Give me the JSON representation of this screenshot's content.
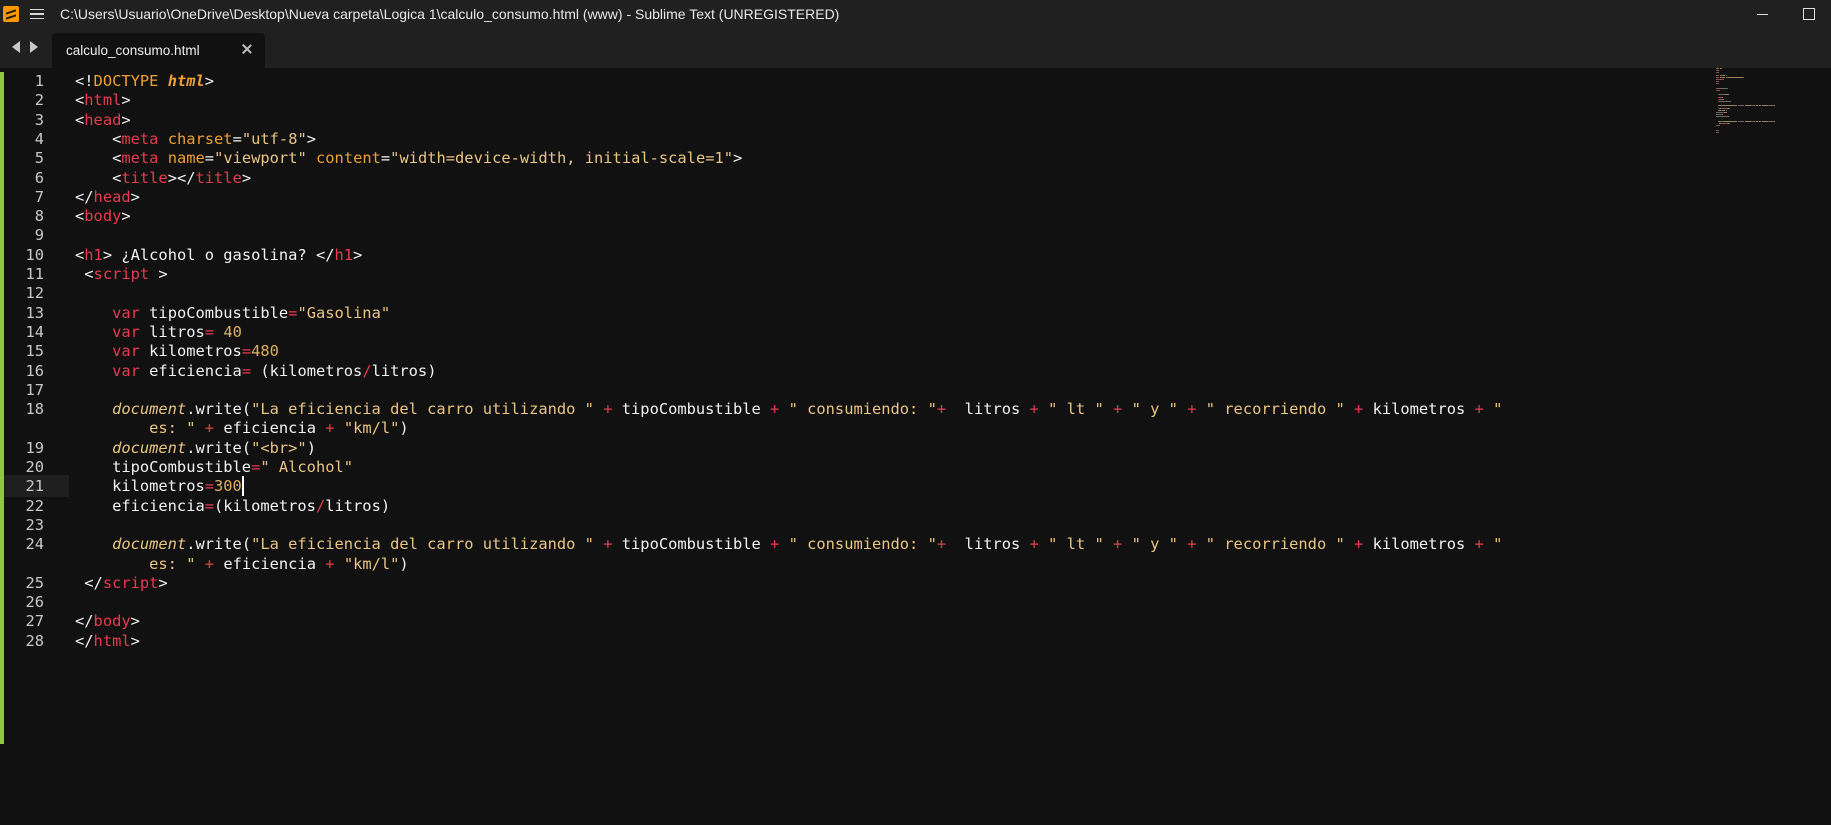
{
  "window": {
    "title": "C:\\Users\\Usuario\\OneDrive\\Desktop\\Nueva carpeta\\Logica 1\\calculo_consumo.html (www) - Sublime Text (UNREGISTERED)"
  },
  "tabs": [
    {
      "label": "calculo_consumo.html",
      "active": true
    }
  ],
  "icons": {
    "app": "sublime-text-icon",
    "menu": "hamburger-menu-icon",
    "back": "arrow-left-icon",
    "forward": "arrow-right-icon",
    "close_tab": "close-icon",
    "minimize": "minimize-icon",
    "maximize": "maximize-icon"
  },
  "colors": {
    "tag": "#e83a4f",
    "attribute": "#f0a030",
    "string": "#eac584",
    "keyword": "#e83a4f",
    "modified_gutter": "#8fc93a",
    "background": "#111111"
  },
  "editor": {
    "cursor_line": 21,
    "lines": [
      {
        "n": "1",
        "segs": [
          [
            "<!",
            "t-punc"
          ],
          [
            "DOCTYPE",
            "t-attr"
          ],
          [
            " ",
            "t-punc"
          ],
          [
            "html",
            "t-doctype"
          ],
          [
            ">",
            "t-punc"
          ]
        ]
      },
      {
        "n": "2",
        "segs": [
          [
            "<",
            "t-punc"
          ],
          [
            "html",
            "t-tag"
          ],
          [
            ">",
            "t-punc"
          ]
        ]
      },
      {
        "n": "3",
        "segs": [
          [
            "<",
            "t-punc"
          ],
          [
            "head",
            "t-tag"
          ],
          [
            ">",
            "t-punc"
          ]
        ]
      },
      {
        "n": "4",
        "segs": [
          [
            "    <",
            "t-punc"
          ],
          [
            "meta",
            "t-tag"
          ],
          [
            " ",
            "t-punc"
          ],
          [
            "charset",
            "t-attr"
          ],
          [
            "=",
            "t-punc"
          ],
          [
            "\"utf-8\"",
            "t-str"
          ],
          [
            ">",
            "t-punc"
          ]
        ]
      },
      {
        "n": "5",
        "segs": [
          [
            "    <",
            "t-punc"
          ],
          [
            "meta",
            "t-tag"
          ],
          [
            " ",
            "t-punc"
          ],
          [
            "name",
            "t-attr"
          ],
          [
            "=",
            "t-punc"
          ],
          [
            "\"viewport\"",
            "t-str"
          ],
          [
            " ",
            "t-punc"
          ],
          [
            "content",
            "t-attr"
          ],
          [
            "=",
            "t-punc"
          ],
          [
            "\"width=device-width, initial-scale=1\"",
            "t-str"
          ],
          [
            ">",
            "t-punc"
          ]
        ]
      },
      {
        "n": "6",
        "segs": [
          [
            "    <",
            "t-punc"
          ],
          [
            "title",
            "t-tag"
          ],
          [
            "></",
            "t-punc"
          ],
          [
            "title",
            "t-tag"
          ],
          [
            ">",
            "t-punc"
          ]
        ]
      },
      {
        "n": "7",
        "segs": [
          [
            "</",
            "t-punc"
          ],
          [
            "head",
            "t-tag"
          ],
          [
            ">",
            "t-punc"
          ]
        ]
      },
      {
        "n": "8",
        "segs": [
          [
            "<",
            "t-punc"
          ],
          [
            "body",
            "t-tag"
          ],
          [
            ">",
            "t-punc"
          ]
        ]
      },
      {
        "n": "9",
        "segs": []
      },
      {
        "n": "10",
        "segs": [
          [
            "<",
            "t-punc"
          ],
          [
            "h1",
            "t-tag"
          ],
          [
            "> ¿Alcohol o gasolina? </",
            "t-punc"
          ],
          [
            "h1",
            "t-tag"
          ],
          [
            ">",
            "t-punc"
          ]
        ]
      },
      {
        "n": "11",
        "segs": [
          [
            " <",
            "t-punc"
          ],
          [
            "script",
            "t-tag"
          ],
          [
            " >",
            "t-punc"
          ]
        ]
      },
      {
        "n": "12",
        "segs": []
      },
      {
        "n": "13",
        "segs": [
          [
            "    ",
            "t-punc"
          ],
          [
            "var",
            "t-kw"
          ],
          [
            " tipoCombustible",
            "t-punc"
          ],
          [
            "=",
            "t-op"
          ],
          [
            "\"Gasolina\"",
            "t-str"
          ]
        ]
      },
      {
        "n": "14",
        "segs": [
          [
            "    ",
            "t-punc"
          ],
          [
            "var",
            "t-kw"
          ],
          [
            " litros",
            "t-punc"
          ],
          [
            "=",
            "t-op"
          ],
          [
            " 40",
            "t-num"
          ]
        ]
      },
      {
        "n": "15",
        "segs": [
          [
            "    ",
            "t-punc"
          ],
          [
            "var",
            "t-kw"
          ],
          [
            " kilometros",
            "t-punc"
          ],
          [
            "=",
            "t-op"
          ],
          [
            "480",
            "t-num"
          ]
        ]
      },
      {
        "n": "16",
        "segs": [
          [
            "    ",
            "t-punc"
          ],
          [
            "var",
            "t-kw"
          ],
          [
            " eficiencia",
            "t-punc"
          ],
          [
            "=",
            "t-op"
          ],
          [
            " (kilometros",
            "t-punc"
          ],
          [
            "/",
            "t-op"
          ],
          [
            "litros)",
            "t-punc"
          ]
        ]
      },
      {
        "n": "17",
        "segs": []
      },
      {
        "n": "18",
        "segs": [
          [
            "    ",
            "t-punc"
          ],
          [
            "document",
            "t-obj"
          ],
          [
            ".write(",
            "t-punc"
          ],
          [
            "\"La eficiencia del carro utilizando \"",
            "t-str"
          ],
          [
            " ",
            "t-punc"
          ],
          [
            "+",
            "t-op"
          ],
          [
            " tipoCombustible ",
            "t-punc"
          ],
          [
            "+",
            "t-op"
          ],
          [
            " ",
            "t-punc"
          ],
          [
            "\" consumiendo: \"",
            "t-str"
          ],
          [
            "+",
            "t-op"
          ],
          [
            "  litros ",
            "t-punc"
          ],
          [
            "+",
            "t-op"
          ],
          [
            " ",
            "t-punc"
          ],
          [
            "\" lt \"",
            "t-str"
          ],
          [
            " ",
            "t-punc"
          ],
          [
            "+",
            "t-op"
          ],
          [
            " ",
            "t-punc"
          ],
          [
            "\" y \"",
            "t-str"
          ],
          [
            " ",
            "t-punc"
          ],
          [
            "+",
            "t-op"
          ],
          [
            " ",
            "t-punc"
          ],
          [
            "\" recorriendo \"",
            "t-str"
          ],
          [
            " ",
            "t-punc"
          ],
          [
            "+",
            "t-op"
          ],
          [
            " kilometros ",
            "t-punc"
          ],
          [
            "+",
            "t-op"
          ],
          [
            " ",
            "t-punc"
          ],
          [
            "\"",
            "t-str"
          ]
        ],
        "wrap": [
          [
            "        ",
            "t-punc"
          ],
          [
            "es: \"",
            "t-str"
          ],
          [
            " ",
            "t-punc"
          ],
          [
            "+",
            "t-op"
          ],
          [
            " eficiencia ",
            "t-punc"
          ],
          [
            "+",
            "t-op"
          ],
          [
            " ",
            "t-punc"
          ],
          [
            "\"km/l\"",
            "t-str"
          ],
          [
            ")",
            "t-punc"
          ]
        ]
      },
      {
        "n": "19",
        "segs": [
          [
            "    ",
            "t-punc"
          ],
          [
            "document",
            "t-obj"
          ],
          [
            ".write(",
            "t-punc"
          ],
          [
            "\"<br>\"",
            "t-str"
          ],
          [
            ")",
            "t-punc"
          ]
        ]
      },
      {
        "n": "20",
        "segs": [
          [
            "    tipoCombustible",
            "t-punc"
          ],
          [
            "=",
            "t-op"
          ],
          [
            "\" Alcohol\"",
            "t-str"
          ]
        ]
      },
      {
        "n": "21",
        "segs": [
          [
            "    kilometros",
            "t-punc"
          ],
          [
            "=",
            "t-op"
          ],
          [
            "300",
            "t-num"
          ]
        ]
      },
      {
        "n": "22",
        "segs": [
          [
            "    eficiencia",
            "t-punc"
          ],
          [
            "=",
            "t-op"
          ],
          [
            "(kilometros",
            "t-punc"
          ],
          [
            "/",
            "t-op"
          ],
          [
            "litros)",
            "t-punc"
          ]
        ]
      },
      {
        "n": "23",
        "segs": []
      },
      {
        "n": "24",
        "segs": [
          [
            "    ",
            "t-punc"
          ],
          [
            "document",
            "t-obj"
          ],
          [
            ".write(",
            "t-punc"
          ],
          [
            "\"La eficiencia del carro utilizando \"",
            "t-str"
          ],
          [
            " ",
            "t-punc"
          ],
          [
            "+",
            "t-op"
          ],
          [
            " tipoCombustible ",
            "t-punc"
          ],
          [
            "+",
            "t-op"
          ],
          [
            " ",
            "t-punc"
          ],
          [
            "\" consumiendo: \"",
            "t-str"
          ],
          [
            "+",
            "t-op"
          ],
          [
            "  litros ",
            "t-punc"
          ],
          [
            "+",
            "t-op"
          ],
          [
            " ",
            "t-punc"
          ],
          [
            "\" lt \"",
            "t-str"
          ],
          [
            " ",
            "t-punc"
          ],
          [
            "+",
            "t-op"
          ],
          [
            " ",
            "t-punc"
          ],
          [
            "\" y \"",
            "t-str"
          ],
          [
            " ",
            "t-punc"
          ],
          [
            "+",
            "t-op"
          ],
          [
            " ",
            "t-punc"
          ],
          [
            "\" recorriendo \"",
            "t-str"
          ],
          [
            " ",
            "t-punc"
          ],
          [
            "+",
            "t-op"
          ],
          [
            " kilometros ",
            "t-punc"
          ],
          [
            "+",
            "t-op"
          ],
          [
            " ",
            "t-punc"
          ],
          [
            "\"",
            "t-str"
          ]
        ],
        "wrap": [
          [
            "        ",
            "t-punc"
          ],
          [
            "es: \"",
            "t-str"
          ],
          [
            " ",
            "t-punc"
          ],
          [
            "+",
            "t-op"
          ],
          [
            " eficiencia ",
            "t-punc"
          ],
          [
            "+",
            "t-op"
          ],
          [
            " ",
            "t-punc"
          ],
          [
            "\"km/l\"",
            "t-str"
          ],
          [
            ")",
            "t-punc"
          ]
        ]
      },
      {
        "n": "25",
        "segs": [
          [
            " </",
            "t-punc"
          ],
          [
            "script",
            "t-tag"
          ],
          [
            ">",
            "t-punc"
          ]
        ]
      },
      {
        "n": "26",
        "segs": []
      },
      {
        "n": "27",
        "segs": [
          [
            "</",
            "t-punc"
          ],
          [
            "body",
            "t-tag"
          ],
          [
            ">",
            "t-punc"
          ]
        ]
      },
      {
        "n": "28",
        "segs": [
          [
            "</",
            "t-punc"
          ],
          [
            "html",
            "t-tag"
          ],
          [
            ">",
            "t-punc"
          ]
        ]
      }
    ]
  }
}
